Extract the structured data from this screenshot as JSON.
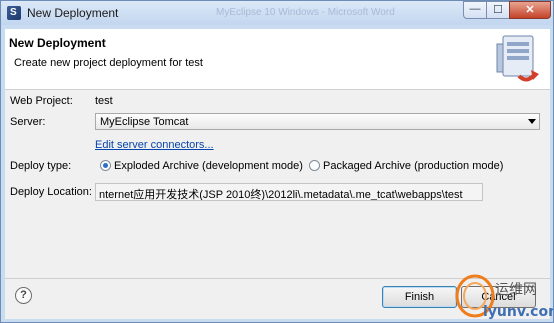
{
  "window": {
    "title": "New Deployment",
    "background_title": "MyEclipse 10 Windows - Microsoft Word",
    "min_glyph": "—",
    "max_glyph": "☐",
    "close_glyph": "✕",
    "app_icon_letter": "S"
  },
  "banner": {
    "title": "New Deployment",
    "description": "Create new project deployment for test",
    "graphic_icon": "deploy-wizard-icon"
  },
  "form": {
    "web_project_label": "Web Project:",
    "web_project_value": "test",
    "server_label": "Server:",
    "server_value": "MyEclipse Tomcat",
    "edit_connectors_link": "Edit server connectors...",
    "deploy_type_label": "Deploy type:",
    "deploy_type_options": [
      {
        "label": "Exploded Archive (development mode)",
        "selected": true
      },
      {
        "label": "Packaged Archive (production mode)",
        "selected": false
      }
    ],
    "deploy_location_label": "Deploy Location:",
    "deploy_location_value": "nternet应用开发技术(JSP 2010终)\\2012li\\.metadata\\.me_tcat\\webapps\\test"
  },
  "footer": {
    "help_glyph": "?",
    "finish_label": "Finish",
    "cancel_label": "Cancel"
  },
  "watermark": {
    "line1": "运维网",
    "line2": "iyunv.com"
  },
  "colors": {
    "title_bar": "#c3d6ef",
    "close_button": "#c5432a",
    "radio_selected": "#2a6ec9",
    "link": "#0645ad"
  }
}
